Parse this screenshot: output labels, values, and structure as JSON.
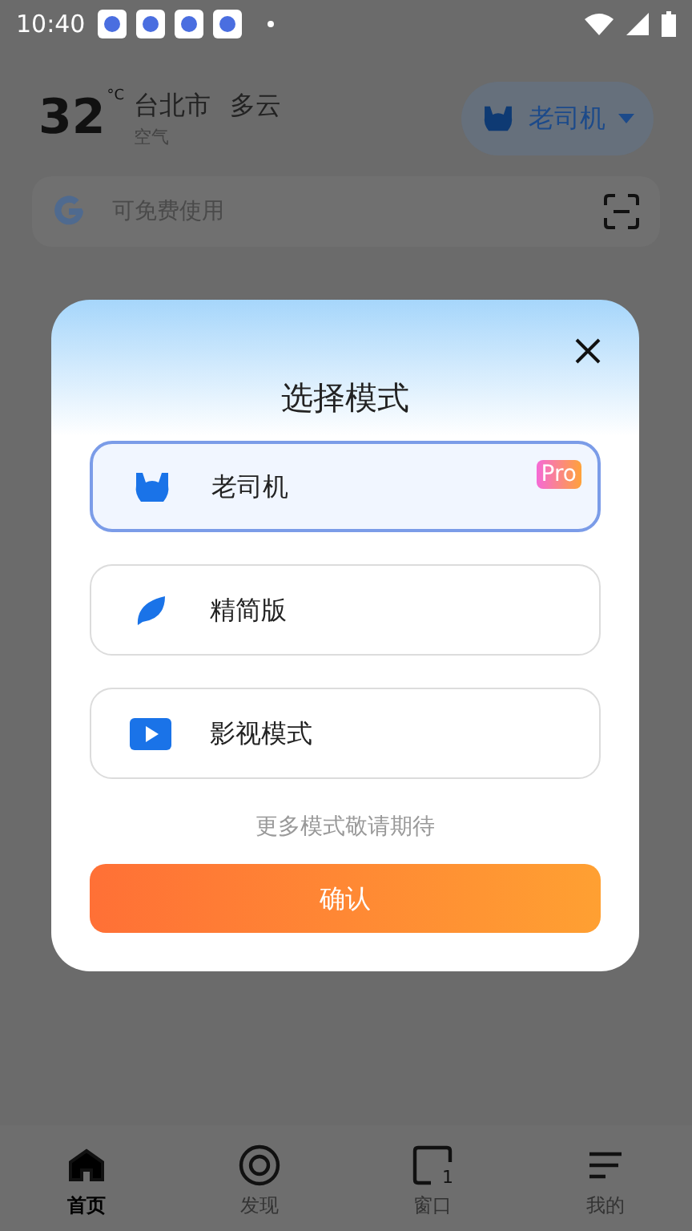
{
  "status_bar": {
    "time": "10:40"
  },
  "weather": {
    "temperature": "32",
    "unit": "°C",
    "city": "台北市",
    "condition": "多云",
    "air": "空气"
  },
  "mode_switch": {
    "label": "老司机"
  },
  "search": {
    "placeholder": "可免费使用"
  },
  "dialog": {
    "title": "选择模式",
    "modes": [
      {
        "kind": "driver",
        "label": "老司机",
        "selected": true,
        "badge": "Pro"
      },
      {
        "kind": "lite",
        "label": "精简版",
        "selected": false
      },
      {
        "kind": "video",
        "label": "影视模式",
        "selected": false
      }
    ],
    "note": "更多模式敬请期待",
    "confirm": "确认"
  },
  "bottom_nav": [
    {
      "kind": "home",
      "label": "首页",
      "selected": true
    },
    {
      "kind": "discover",
      "label": "发现",
      "selected": false
    },
    {
      "kind": "window",
      "label": "窗口",
      "selected": false,
      "count": "1"
    },
    {
      "kind": "me",
      "label": "我的",
      "selected": false
    }
  ]
}
